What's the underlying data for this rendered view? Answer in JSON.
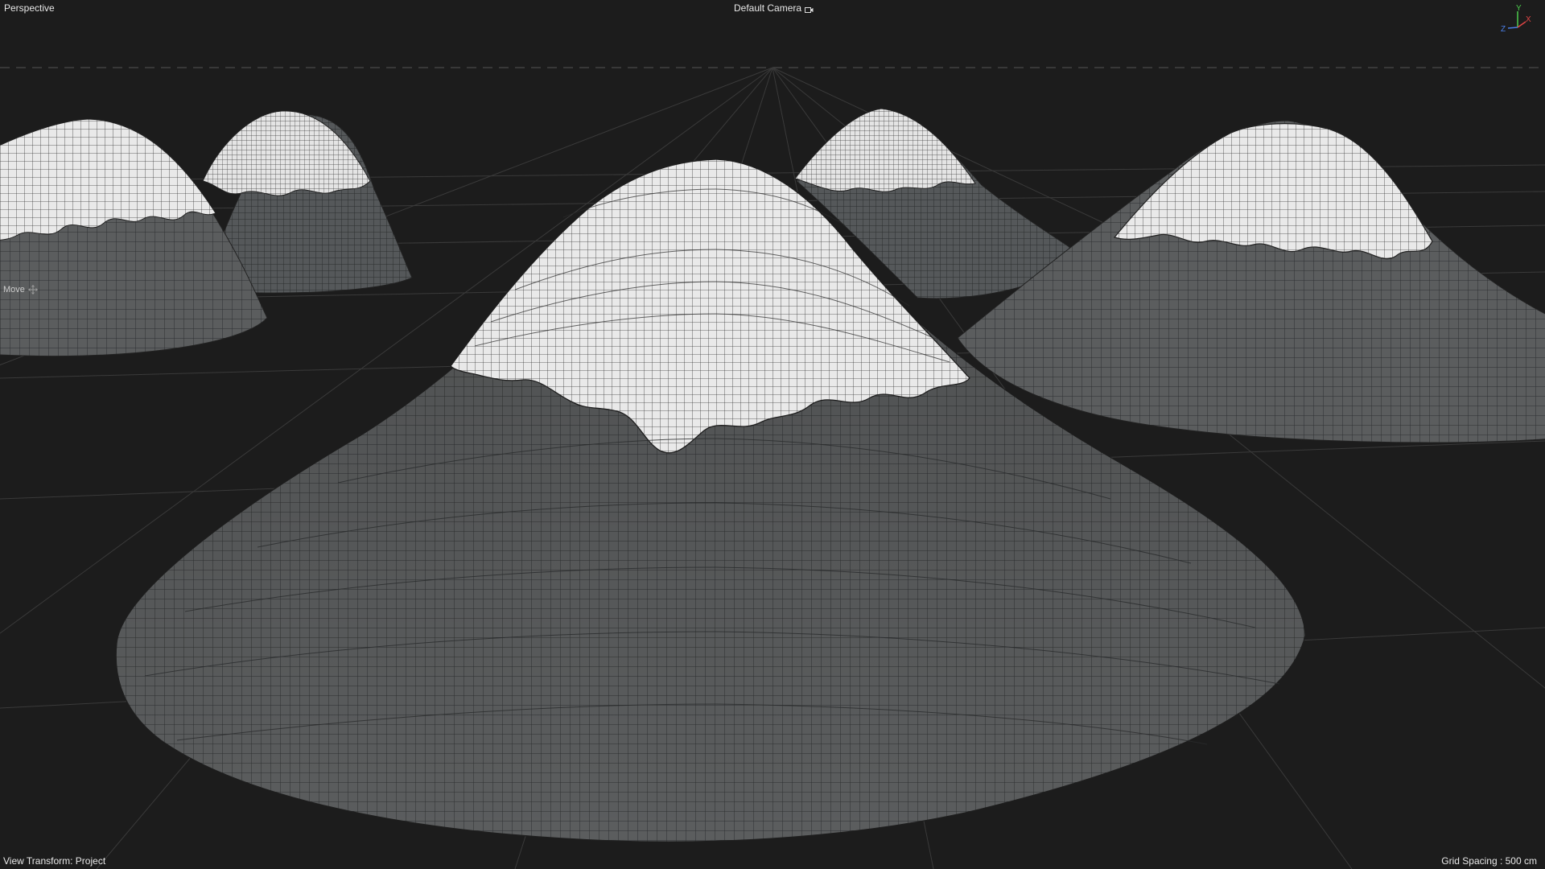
{
  "viewport": {
    "view_name": "Perspective",
    "camera_name": "Default Camera",
    "active_tool": "Move",
    "view_transform": "View Transform: Project",
    "grid_spacing": "Grid Spacing : 500 cm",
    "background_color": "#1c1c1c"
  },
  "axis_gizmo": {
    "y": "Y",
    "x": "X",
    "z": "Z",
    "x_color": "#e04545",
    "y_color": "#4ccd4c",
    "z_color": "#4a7fe8"
  },
  "icons": [
    "camera-icon",
    "move-tool-icon"
  ],
  "mountains": [
    {
      "name": "mountain-front-center"
    },
    {
      "name": "mountain-right"
    },
    {
      "name": "mountain-back-center-right"
    },
    {
      "name": "mountain-left"
    },
    {
      "name": "mountain-back-left"
    }
  ]
}
